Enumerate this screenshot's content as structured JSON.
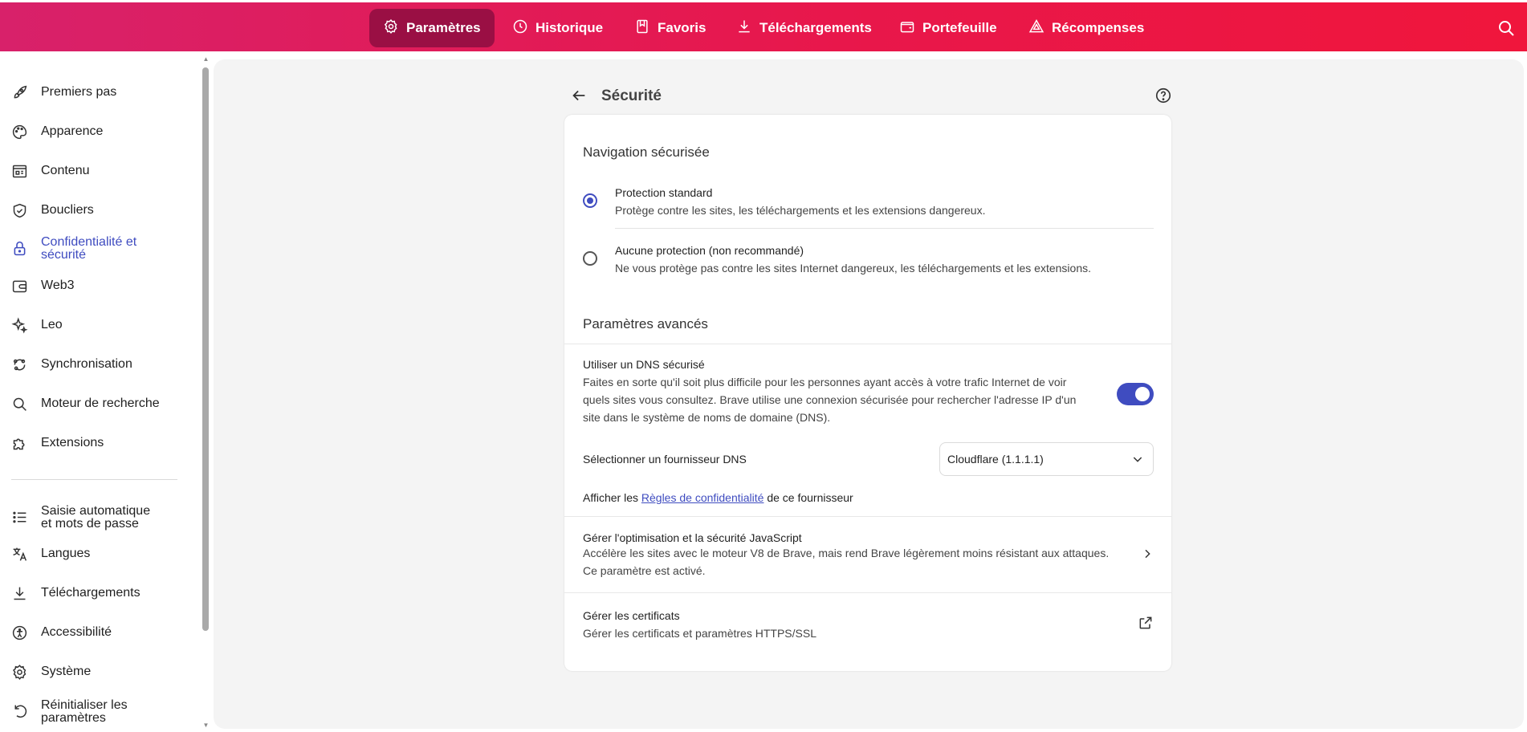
{
  "topnav": {
    "items": [
      {
        "label": "Paramètres",
        "icon": "gear-icon",
        "active": true
      },
      {
        "label": "Historique",
        "icon": "history-icon"
      },
      {
        "label": "Favoris",
        "icon": "bookmark-icon"
      },
      {
        "label": "Téléchargements",
        "icon": "download-icon"
      },
      {
        "label": "Portefeuille",
        "icon": "wallet-icon"
      },
      {
        "label": "Récompenses",
        "icon": "rewards-triangle-icon"
      }
    ],
    "search_icon": "search-icon"
  },
  "sidebar": {
    "items": [
      {
        "label": "Premiers pas",
        "icon": "rocket-icon"
      },
      {
        "label": "Apparence",
        "icon": "palette-icon"
      },
      {
        "label": "Contenu",
        "icon": "content-icon"
      },
      {
        "label": "Boucliers",
        "icon": "shield-icon"
      },
      {
        "label_line1": "Confidentialité et",
        "label_line2": "sécurité",
        "icon": "lock-icon",
        "active": true
      },
      {
        "label": "Web3",
        "icon": "wallet-icon"
      },
      {
        "label": "Leo",
        "icon": "sparkle-icon"
      },
      {
        "label": "Synchronisation",
        "icon": "sync-icon"
      },
      {
        "label": "Moteur de recherche",
        "icon": "search-icon"
      },
      {
        "label": "Extensions",
        "icon": "puzzle-icon"
      },
      {
        "label_line1": "Saisie automatique",
        "label_line2": "et mots de passe",
        "icon": "list-icon"
      },
      {
        "label": "Langues",
        "icon": "translate-icon"
      },
      {
        "label": "Téléchargements",
        "icon": "download-icon"
      },
      {
        "label": "Accessibilité",
        "icon": "accessibility-icon"
      },
      {
        "label": "Système",
        "icon": "gear-icon"
      },
      {
        "label_line1": "Réinitialiser les",
        "label_line2": "paramètres",
        "icon": "reset-icon"
      }
    ]
  },
  "page": {
    "title": "Sécurité",
    "safe_browsing": {
      "section_title": "Navigation sécurisée",
      "options": [
        {
          "title": "Protection standard",
          "desc": "Protège contre les sites, les téléchargements et les extensions dangereux.",
          "checked": true
        },
        {
          "title": "Aucune protection (non recommandé)",
          "desc": "Ne vous protège pas contre les sites Internet dangereux, les téléchargements et les extensions.",
          "checked": false
        }
      ]
    },
    "advanced": {
      "section_title": "Paramètres avancés",
      "secure_dns": {
        "title": "Utiliser un DNS sécurisé",
        "desc_line1": "Faites en sorte qu'il soit plus difficile pour les personnes ayant accès à votre trafic Internet de voir",
        "desc_line2": "quels sites vous consultez. Brave utilise une connexion sécurisée pour rechercher l'adresse IP d'un",
        "desc_line3": "site dans le système de noms de domaine (DNS).",
        "enabled": true
      },
      "dns_provider": {
        "label": "Sélectionner un fournisseur DNS",
        "value": "Cloudflare (1.1.1.1)"
      },
      "privacy_rules": {
        "prefix": "Afficher les ",
        "link": "Règles de confidentialité",
        "suffix": " de ce fournisseur"
      },
      "javascript": {
        "title": "Gérer l'optimisation et la sécurité JavaScript",
        "desc_line1": "Accélère les sites avec le moteur V8 de Brave, mais rend Brave légèrement moins résistant aux attaques.",
        "desc_line2": "Ce paramètre est activé."
      },
      "certificates": {
        "title": "Gérer les certificats",
        "desc": "Gérer les certificats et paramètres HTTPS/SSL"
      }
    }
  }
}
